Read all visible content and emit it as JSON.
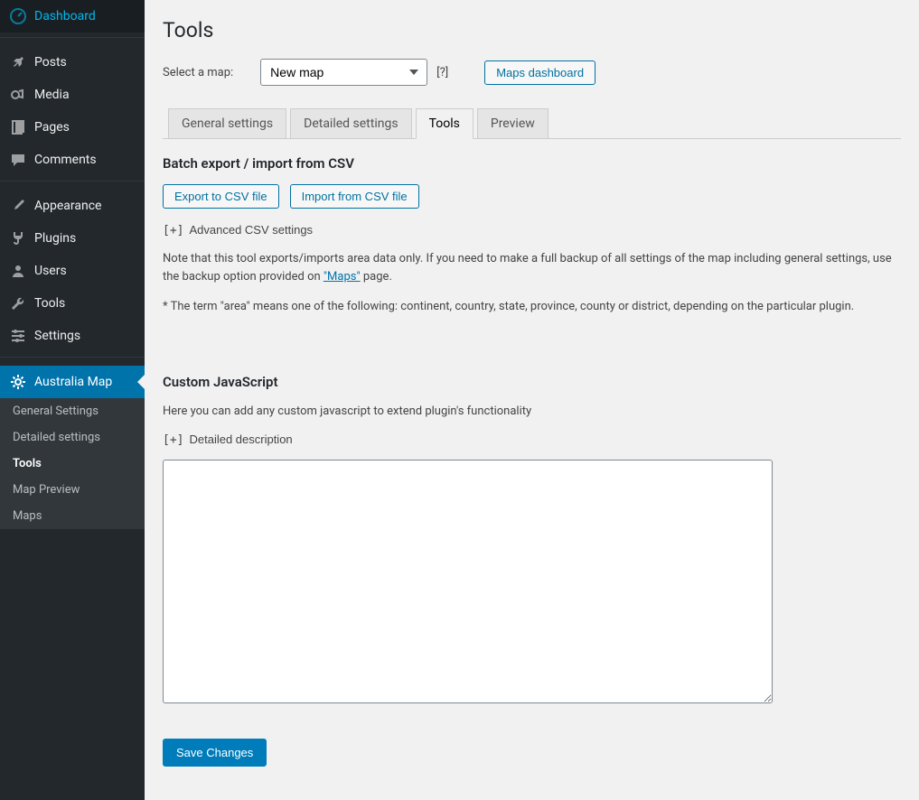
{
  "sidebar": {
    "items": [
      {
        "label": "Dashboard",
        "icon": "dashboard"
      },
      {
        "label": "Posts",
        "icon": "pin"
      },
      {
        "label": "Media",
        "icon": "media"
      },
      {
        "label": "Pages",
        "icon": "page"
      },
      {
        "label": "Comments",
        "icon": "comment"
      },
      {
        "label": "Appearance",
        "icon": "brush"
      },
      {
        "label": "Plugins",
        "icon": "plug"
      },
      {
        "label": "Users",
        "icon": "user"
      },
      {
        "label": "Tools",
        "icon": "wrench"
      },
      {
        "label": "Settings",
        "icon": "sliders"
      },
      {
        "label": "Australia Map",
        "icon": "gear",
        "active": true
      }
    ],
    "submenu": [
      {
        "label": "General Settings"
      },
      {
        "label": "Detailed settings"
      },
      {
        "label": "Tools",
        "active": true
      },
      {
        "label": "Map Preview"
      },
      {
        "label": "Maps"
      }
    ]
  },
  "page": {
    "title": "Tools",
    "select_label": "Select a map:",
    "select_value": "New map",
    "help": "[?]",
    "maps_dashboard": "Maps dashboard"
  },
  "tabs": [
    {
      "label": "General settings"
    },
    {
      "label": "Detailed settings"
    },
    {
      "label": "Tools",
      "active": true
    },
    {
      "label": "Preview"
    }
  ],
  "batch": {
    "heading": "Batch export / import from CSV",
    "export_btn": "Export to CSV file",
    "import_btn": "Import from CSV file",
    "adv_toggle": "[+]",
    "adv_label": "Advanced CSV settings",
    "note_pre": "Note that this tool exports/imports area data only. If you need to make a full backup of all settings of the map including general settings, use the backup option provided on ",
    "note_link": "\"Maps\"",
    "note_post": " page.",
    "footnote": "* The term \"area\" means one of the following: continent, country, state, province, county or district, depending on the particular plugin."
  },
  "customjs": {
    "heading": "Custom JavaScript",
    "desc": "Here you can add any custom javascript to extend plugin's functionality",
    "detail_toggle": "[+]",
    "detail_label": "Detailed description",
    "value": ""
  },
  "save": "Save Changes"
}
